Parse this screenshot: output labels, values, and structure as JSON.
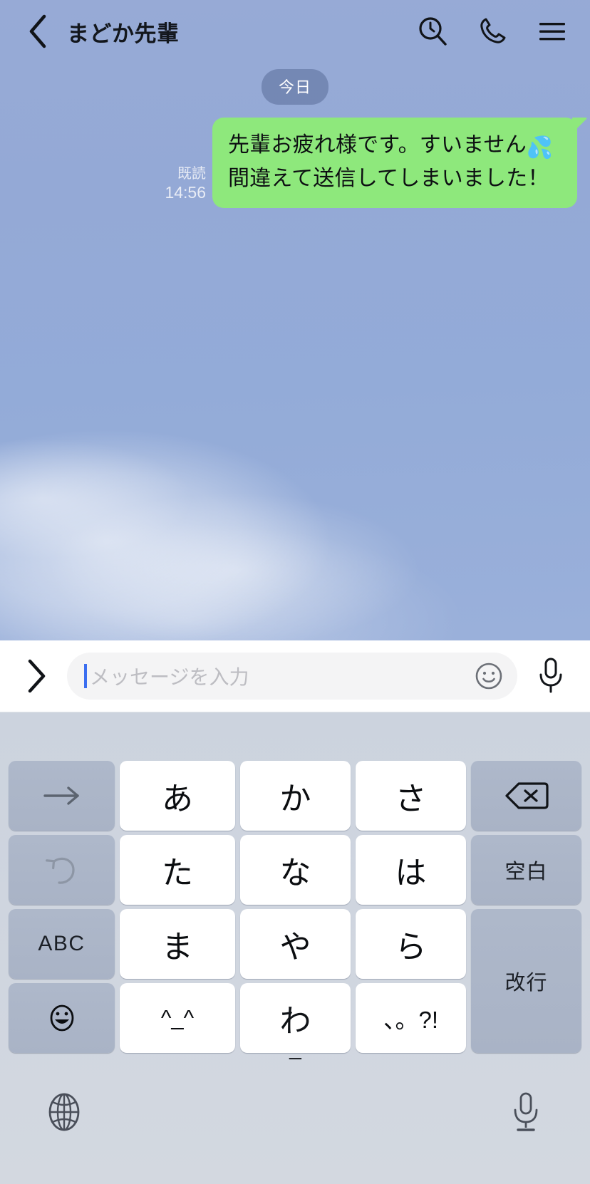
{
  "header": {
    "back_icon": "chevron-left-icon",
    "title": "まどか先輩",
    "search_icon": "search-history-icon",
    "call_icon": "phone-icon",
    "menu_icon": "hamburger-menu-icon"
  },
  "chat": {
    "date_divider": "今日",
    "messages": [
      {
        "side": "outgoing",
        "read_status": "既読",
        "time": "14:56",
        "text_part1": "先輩お疲れ様です。すいません",
        "emoji": "💦",
        "text_part2": "間違えて送信してしまいました！",
        "bubble_color": "#8ee87c"
      }
    ]
  },
  "input_bar": {
    "expand_icon": "chevron-right-icon",
    "value": "",
    "placeholder": "メッセージを入力",
    "emoji_icon": "smiley-face-icon",
    "mic_icon": "microphone-icon"
  },
  "keyboard": {
    "rows": [
      [
        {
          "label": "→",
          "type": "fn",
          "name": "cursor-right-key"
        },
        {
          "label": "あ",
          "type": "kana",
          "name": "key-a"
        },
        {
          "label": "か",
          "type": "kana",
          "name": "key-ka"
        },
        {
          "label": "さ",
          "type": "kana",
          "name": "key-sa"
        },
        {
          "label": "⌫",
          "type": "fn",
          "name": "backspace-key"
        }
      ],
      [
        {
          "label": "↺",
          "type": "fn",
          "name": "undo-key"
        },
        {
          "label": "た",
          "type": "kana",
          "name": "key-ta"
        },
        {
          "label": "な",
          "type": "kana",
          "name": "key-na"
        },
        {
          "label": "は",
          "type": "kana",
          "name": "key-ha"
        },
        {
          "label": "空白",
          "type": "fn",
          "name": "space-key"
        }
      ],
      [
        {
          "label": "ABC",
          "type": "fn",
          "name": "abc-key"
        },
        {
          "label": "ま",
          "type": "kana",
          "name": "key-ma"
        },
        {
          "label": "や",
          "type": "kana",
          "name": "key-ya"
        },
        {
          "label": "ら",
          "type": "kana",
          "name": "key-ra"
        },
        {
          "label": "改行",
          "type": "fn",
          "name": "return-key"
        }
      ],
      [
        {
          "label": "☺",
          "type": "fn",
          "name": "emoji-key"
        },
        {
          "label": "^_^",
          "type": "kaomoji",
          "name": "kaomoji-key"
        },
        {
          "label": "わ",
          "type": "kana",
          "name": "key-wa"
        },
        {
          "label": "、。?!",
          "type": "punct",
          "name": "punctuation-key"
        }
      ]
    ],
    "bottom": {
      "globe_icon": "globe-language-icon",
      "mic_icon": "microphone-dictation-icon"
    }
  },
  "colors": {
    "chat_bg": "#96a9d6",
    "bubble_green": "#8ee87c",
    "key_white": "#ffffff",
    "key_fn": "#aeb8ca",
    "keyboard_bg": "#cfd5df",
    "caret_blue": "#3b6ef0"
  }
}
